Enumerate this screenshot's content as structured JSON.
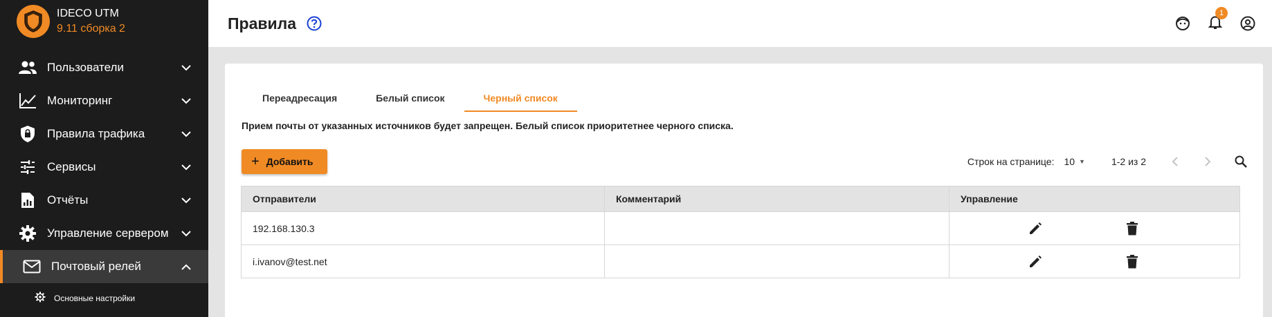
{
  "app": {
    "name": "IDECO UTM",
    "version": "9.11 сборка 2"
  },
  "sidebar": {
    "items": [
      {
        "label": "Пользователи",
        "icon": "users-icon"
      },
      {
        "label": "Мониторинг",
        "icon": "chart-line-icon"
      },
      {
        "label": "Правила трафика",
        "icon": "shield-lock-icon"
      },
      {
        "label": "Сервисы",
        "icon": "sliders-icon"
      },
      {
        "label": "Отчёты",
        "icon": "report-icon"
      },
      {
        "label": "Управление сервером",
        "icon": "gear-icon"
      },
      {
        "label": "Почтовый релей",
        "icon": "mail-icon"
      }
    ],
    "subitems": [
      {
        "label": "Основные настройки",
        "icon": "gear-small-icon"
      }
    ]
  },
  "header": {
    "title": "Правила",
    "notification_count": "1"
  },
  "tabs": [
    {
      "label": "Переадресация"
    },
    {
      "label": "Белый список"
    },
    {
      "label": "Черный список"
    }
  ],
  "description": "Прием почты от указанных источников будет запрещен. Белый список приоритетнее черного списка.",
  "toolbar": {
    "add_label": "Добавить",
    "rows_label": "Строк на странице:",
    "rows_value": "10",
    "range": "1-2 из 2"
  },
  "table": {
    "columns": [
      "Отправители",
      "Комментарий",
      "Управление"
    ],
    "rows": [
      {
        "sender": "192.168.130.3",
        "comment": ""
      },
      {
        "sender": "i.ivanov@test.net",
        "comment": ""
      }
    ]
  },
  "colors": {
    "accent": "#f08a24",
    "sidebar_bg": "#1c1c1c",
    "help_icon": "#1a3fd6"
  }
}
